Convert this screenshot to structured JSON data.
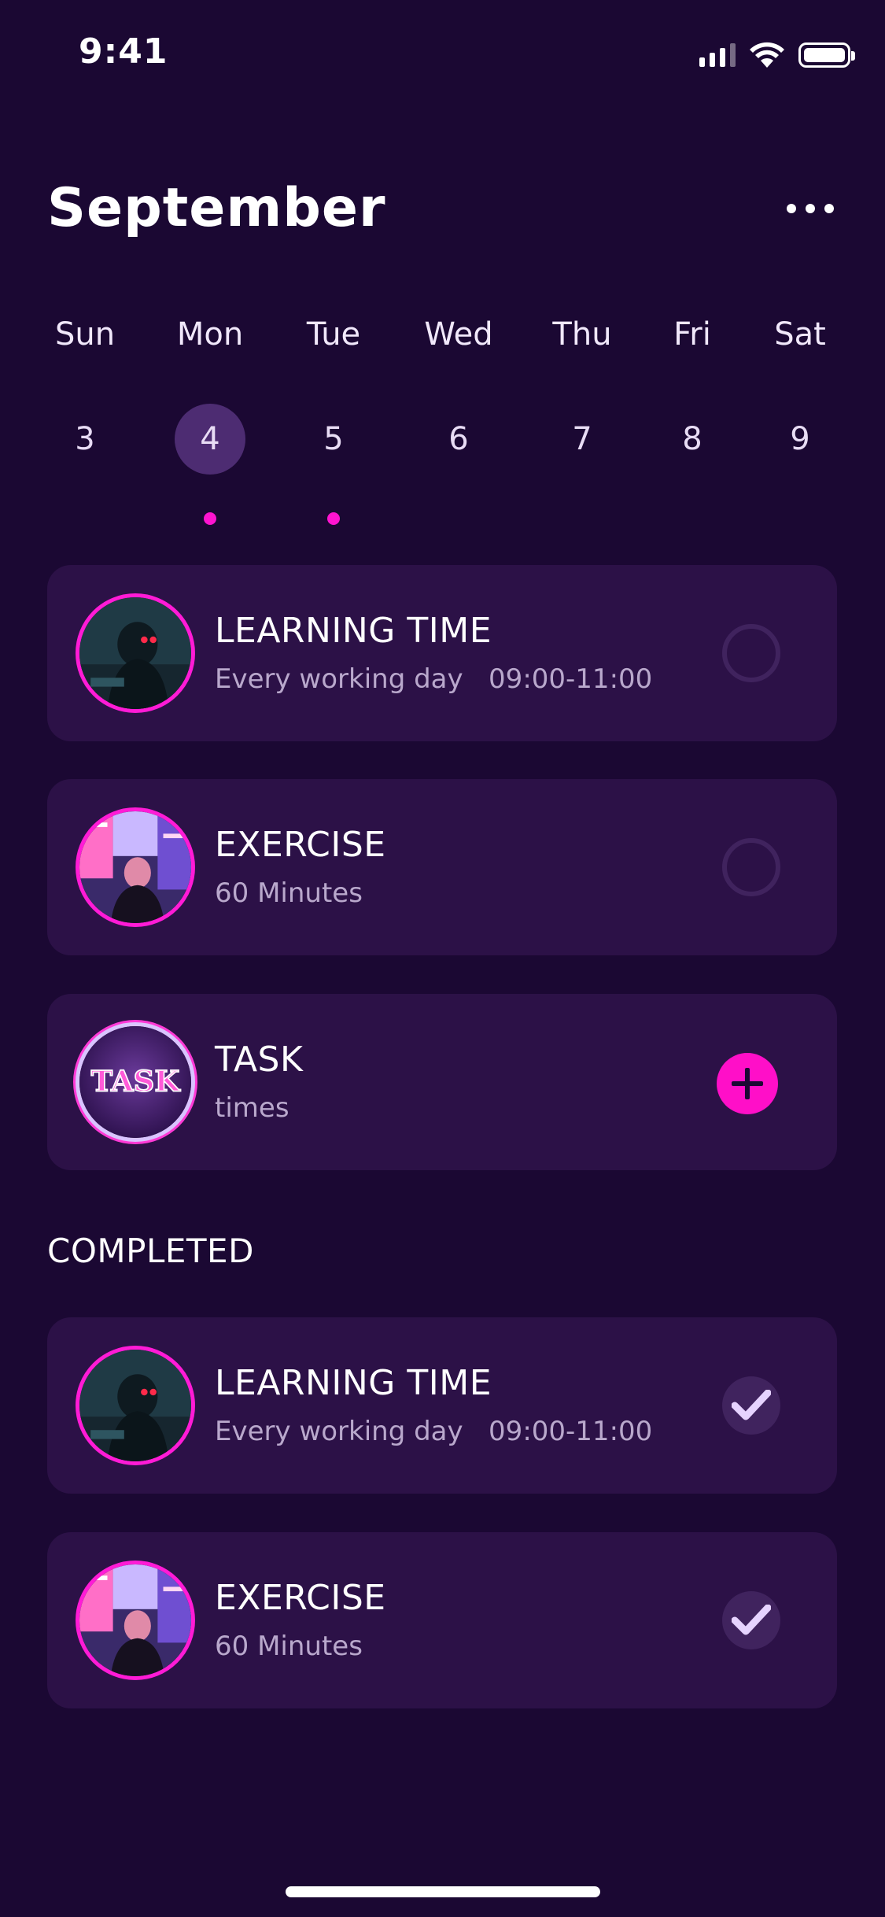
{
  "status_bar": {
    "time": "9:41",
    "icons": [
      "signal-icon",
      "wifi-icon",
      "battery-icon"
    ]
  },
  "header": {
    "month": "September",
    "menu_icon": "more-icon"
  },
  "week": {
    "days": [
      {
        "name": "Sun",
        "num": "3",
        "selected": false,
        "dot": false
      },
      {
        "name": "Mon",
        "num": "4",
        "selected": true,
        "dot": true
      },
      {
        "name": "Tue",
        "num": "5",
        "selected": false,
        "dot": true
      },
      {
        "name": "Wed",
        "num": "6",
        "selected": false,
        "dot": false
      },
      {
        "name": "Thu",
        "num": "7",
        "selected": false,
        "dot": false
      },
      {
        "name": "Fri",
        "num": "8",
        "selected": false,
        "dot": false
      },
      {
        "name": "Sat",
        "num": "9",
        "selected": false,
        "dot": false
      }
    ]
  },
  "tasks": [
    {
      "title": "LEARNING TIME",
      "subtitle": "Every working day   09:00-11:00",
      "state": "pending"
    },
    {
      "title": "EXERCISE",
      "subtitle": "60 Minutes",
      "state": "pending"
    },
    {
      "title": "TASK",
      "subtitle": "times",
      "state": "add",
      "avatar_text": "TASK"
    }
  ],
  "completed_label": "COMPLETED",
  "completed": [
    {
      "title": "LEARNING TIME",
      "subtitle": "Every working day   09:00-11:00",
      "state": "done"
    },
    {
      "title": "EXERCISE",
      "subtitle": "60 Minutes",
      "state": "done"
    }
  ],
  "colors": {
    "background": "#1b0833",
    "card": "#2c1147",
    "accent": "#ff14d0",
    "selected_day": "#4d2c72"
  }
}
